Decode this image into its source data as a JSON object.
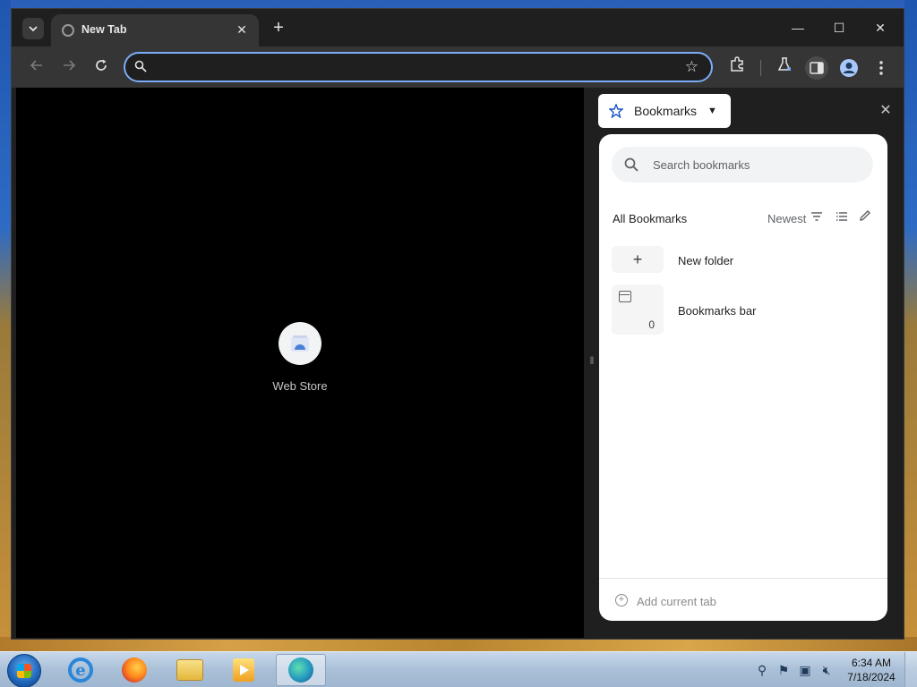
{
  "browser": {
    "tab": {
      "title": "New Tab",
      "close_label": "✕"
    },
    "new_tab_label": "+",
    "window_controls": {
      "minimize": "—",
      "maximize": "☐",
      "close": "✕"
    },
    "omnibox": {
      "value": "",
      "placeholder": ""
    }
  },
  "new_tab_page": {
    "shortcuts": [
      {
        "label": "Web Store"
      }
    ]
  },
  "side_panel": {
    "selector_label": "Bookmarks",
    "search_placeholder": "Search bookmarks",
    "heading": "All Bookmarks",
    "sort_label": "Newest",
    "items": [
      {
        "label": "New folder",
        "icon": "plus-icon",
        "glyph": "+"
      },
      {
        "label": "Bookmarks bar",
        "icon": "folder-icon",
        "count": "0"
      }
    ],
    "footer_label": "Add current tab"
  },
  "taskbar": {
    "apps": [
      "internet-explorer",
      "firefox",
      "file-explorer",
      "media-player",
      "edge"
    ],
    "clock": {
      "time": "6:34 AM",
      "date": "7/18/2024"
    }
  },
  "colors": {
    "accent": "#7cacf8",
    "panel_bg": "#ffffff",
    "chrome_dark": "#1f1f1f",
    "toolbar": "#353535"
  }
}
